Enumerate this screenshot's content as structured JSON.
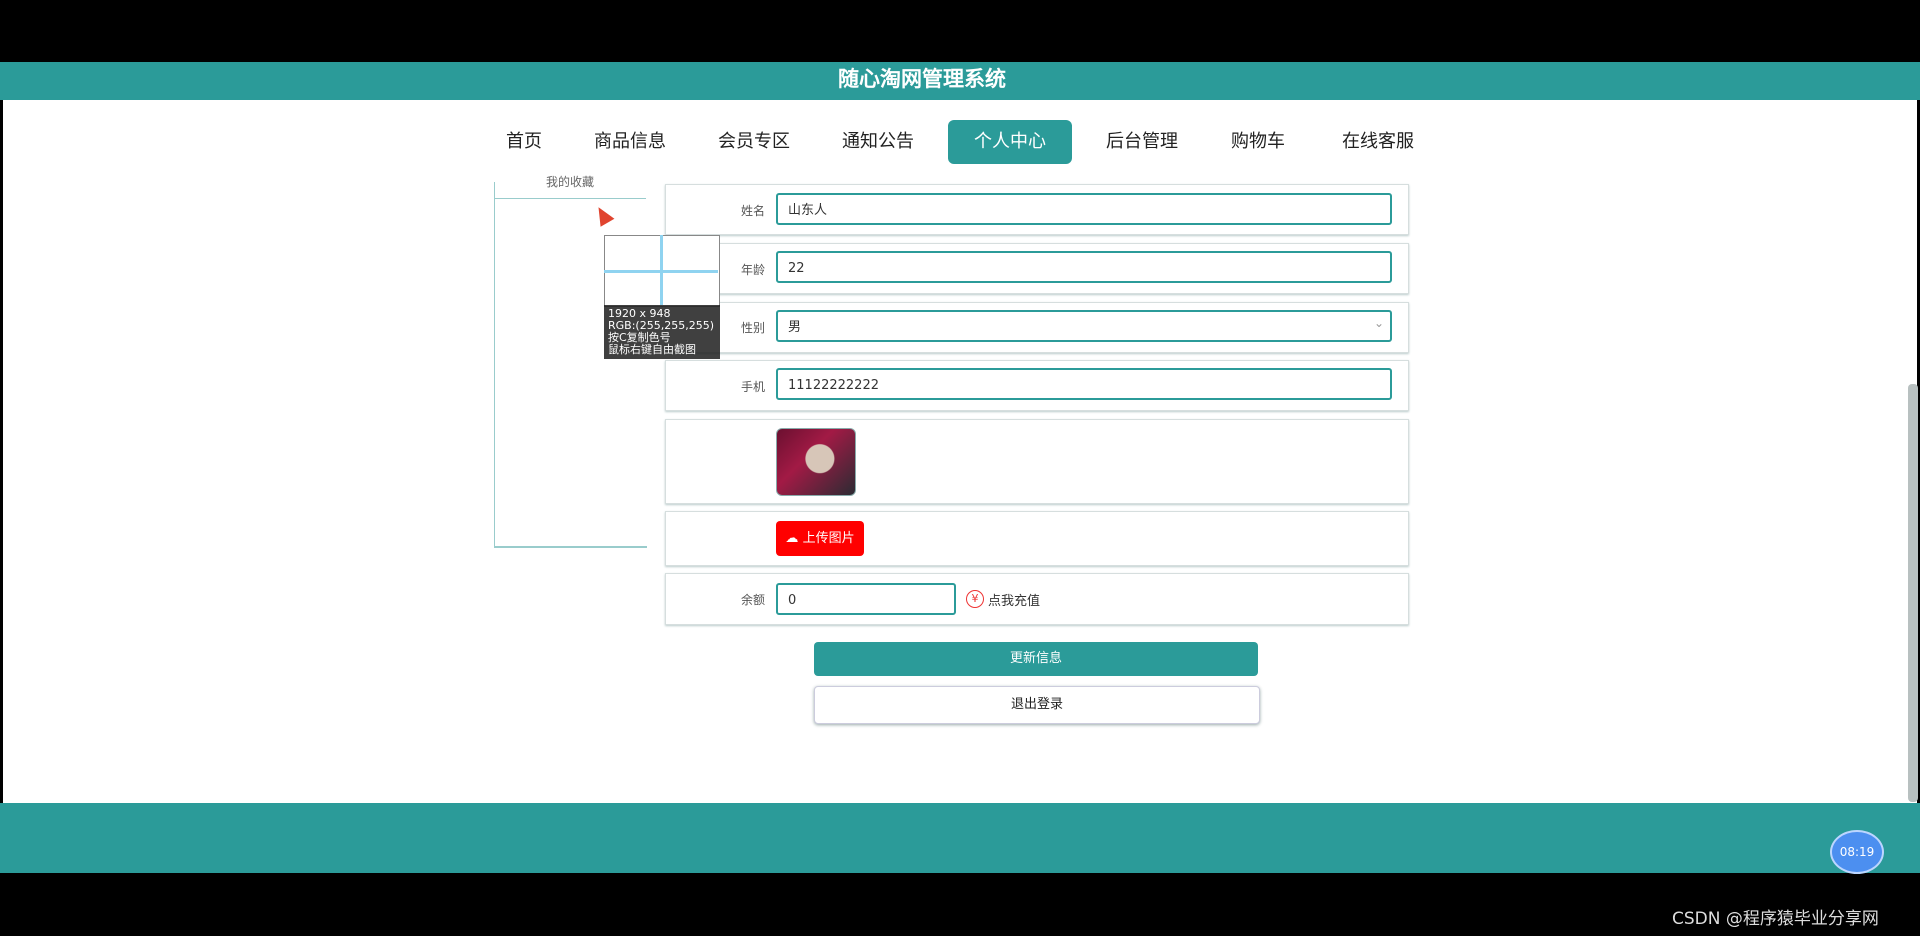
{
  "app_title": "随心淘网管理系统",
  "nav": {
    "items": [
      "首页",
      "商品信息",
      "会员专区",
      "通知公告",
      "个人中心",
      "后台管理",
      "购物车",
      "在线客服"
    ],
    "active": "个人中心"
  },
  "sidebar": {
    "item_partial": "我的收藏"
  },
  "form": {
    "name_label": "姓名",
    "name_value": "山东人",
    "age_label": "年龄",
    "age_value": "22",
    "gender_label": "性别",
    "gender_value": "男",
    "phone_label": "手机",
    "phone_value": "11122222222",
    "upload_label": "上传图片",
    "balance_label": "余额",
    "balance_value": "0",
    "recharge_icon": "¥",
    "recharge_label": "点我充值",
    "update_button": "更新信息",
    "logout_button": "退出登录"
  },
  "screenshot_tool": {
    "line1": "1920 x 948",
    "line2": "RGB:(255,255,255)",
    "line3": "按C复制色号",
    "line4": "鼠标右键自由截图"
  },
  "clock": "08:19",
  "watermark": "CSDN @程序猿毕业分享网",
  "colors": {
    "teal": "#2b9b99",
    "upload_red": "#ff0000"
  }
}
